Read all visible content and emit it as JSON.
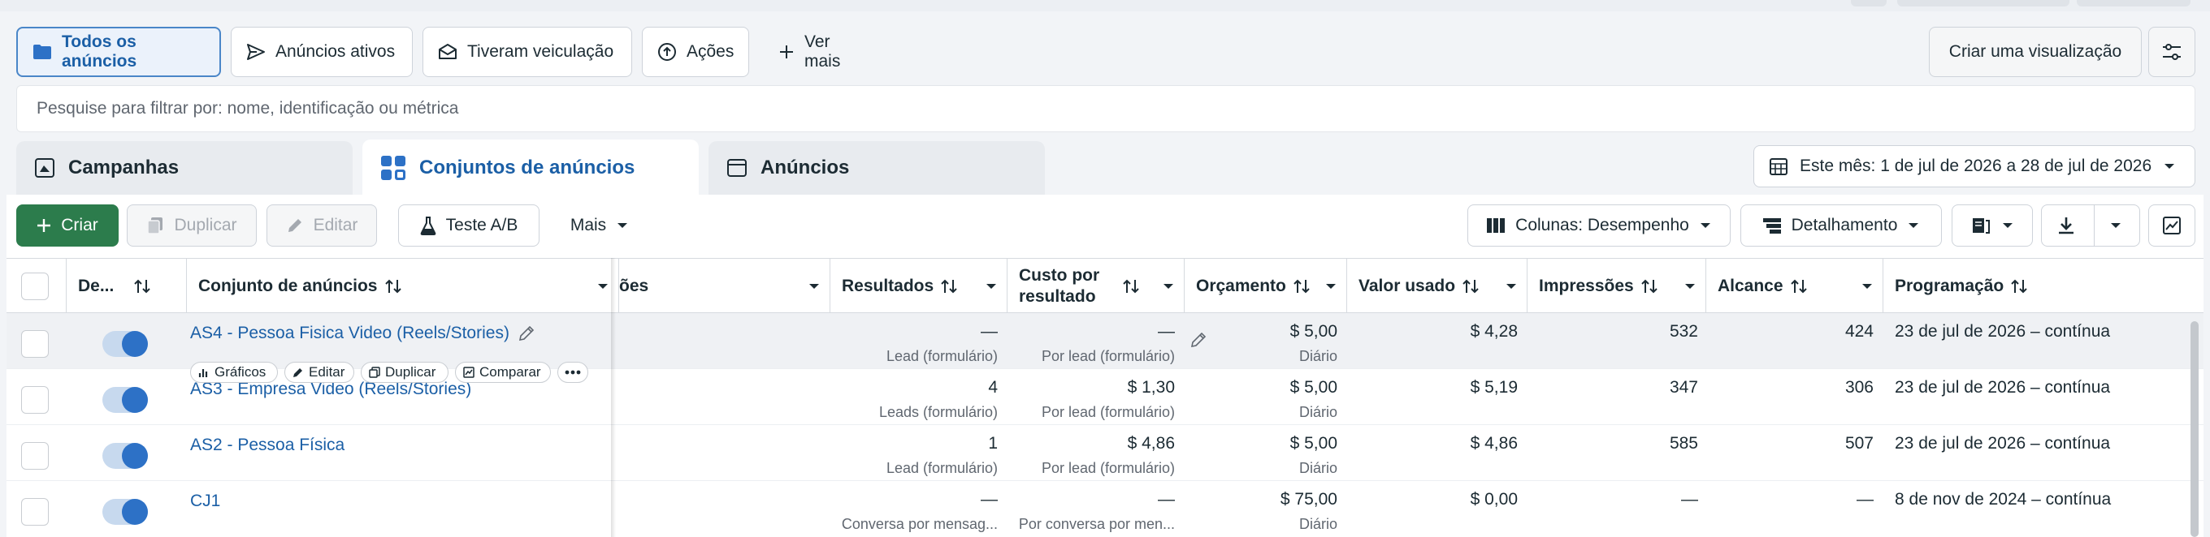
{
  "views": {
    "all": "Todos os anúncios",
    "active": "Anúncios ativos",
    "delivered": "Tiveram veiculação",
    "actions": "Ações",
    "more": "Ver mais",
    "create_view": "Criar uma visualização"
  },
  "search": {
    "placeholder": "Pesquise para filtrar por: nome, identificação ou métrica"
  },
  "levels": {
    "campaigns": "Campanhas",
    "adsets": "Conjuntos de anúncios",
    "ads": "Anúncios"
  },
  "date_range": "Este mês: 1 de jul de 2026 a 28 de jul de 2026",
  "toolbar": {
    "create": "Criar",
    "duplicate": "Duplicar",
    "edit": "Editar",
    "ab_test": "Teste A/B",
    "more": "Mais",
    "columns": "Colunas: Desempenho",
    "breakdown": "Detalhamento"
  },
  "columns": {
    "delivery": "De...",
    "name": "Conjunto de anúncios",
    "partial": "ões",
    "results": "Resultados",
    "cost_line1": "Custo por",
    "cost_line2": "resultado",
    "budget": "Orçamento",
    "spent": "Valor usado",
    "impressions": "Impressões",
    "reach": "Alcance",
    "schedule": "Programação"
  },
  "row_actions": {
    "charts": "Gráficos",
    "edit": "Editar",
    "duplicate": "Duplicar",
    "compare": "Comparar"
  },
  "rows": [
    {
      "name": "AS4 - Pessoa Fisica Video (Reels/Stories)",
      "results": "—",
      "results_sub": "Lead (formulário)",
      "cost": "—",
      "cost_sub": "Por lead (formulário)",
      "budget": "$ 5,00",
      "budget_sub": "Diário",
      "spent": "$ 4,28",
      "impressions": "532",
      "reach": "424",
      "schedule": "23 de jul de 2026 – contínua"
    },
    {
      "name": "AS3 - Empresa Video (Reels/Stories)",
      "results": "4",
      "results_sub": "Leads (formulário)",
      "cost": "$ 1,30",
      "cost_sub": "Por lead (formulário)",
      "budget": "$ 5,00",
      "budget_sub": "Diário",
      "spent": "$ 5,19",
      "impressions": "347",
      "reach": "306",
      "schedule": "23 de jul de 2026 – contínua"
    },
    {
      "name": "AS2 - Pessoa Física",
      "results": "1",
      "results_sub": "Lead (formulário)",
      "cost": "$ 4,86",
      "cost_sub": "Por lead (formulário)",
      "budget": "$ 5,00",
      "budget_sub": "Diário",
      "spent": "$ 4,86",
      "impressions": "585",
      "reach": "507",
      "schedule": "23 de jul de 2026 – contínua"
    },
    {
      "name": "CJ1",
      "results": "—",
      "results_sub": "Conversa por mensag...",
      "cost": "—",
      "cost_sub": "Por conversa por men...",
      "budget": "$ 75,00",
      "budget_sub": "Diário",
      "spent": "$ 0,00",
      "impressions": "—",
      "reach": "—",
      "schedule": "8 de nov de 2024 – contínua"
    }
  ],
  "icons": [
    "folder-icon",
    "send-icon",
    "envelope-icon",
    "arrow-up-circle-icon",
    "plus-icon",
    "sliders-icon",
    "image-icon",
    "grid-icon",
    "ad-icon",
    "calendar-icon",
    "chevron-down-icon",
    "copy-icon",
    "pencil-icon",
    "flask-icon",
    "columns-icon",
    "breakdown-icon",
    "report-icon",
    "download-icon",
    "chart-icon",
    "sort-icon",
    "bar-chart-icon",
    "compare-icon",
    "ellipsis-icon"
  ],
  "colors": {
    "accent": "#1b5fa6",
    "create_green": "#2c7c4c",
    "toggle_on": "#2d71c6"
  }
}
